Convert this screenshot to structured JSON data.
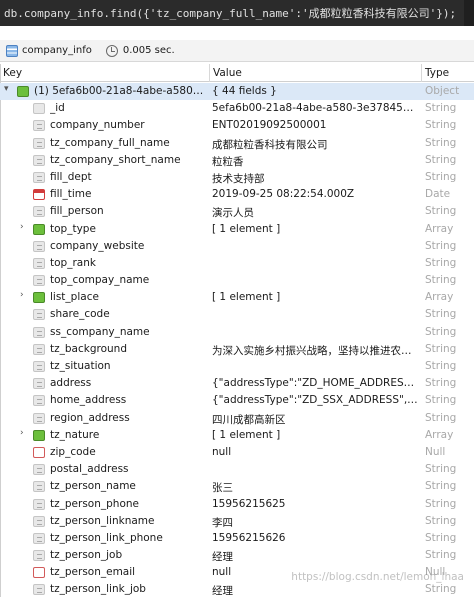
{
  "query": "db.company_info.find({'tz_company_full_name':'成都粒粒香科技有限公司'});",
  "status": {
    "collection": "company_info",
    "elapsed": "0.005 sec."
  },
  "columns": {
    "key": "Key",
    "value": "Value",
    "type": "Type"
  },
  "rows": [
    {
      "key": "(1) 5efa6b00-21a8-4abe-a580-3e3...",
      "value": "{ 44 fields }",
      "type": "Object",
      "icon": "obj",
      "expander": "▾"
    },
    {
      "key": "_id",
      "value": "5efa6b00-21a8-4abe-a580-3e378458f9c3",
      "type": "String",
      "icon": "id"
    },
    {
      "key": "company_number",
      "value": "ENT02019092500001",
      "type": "String",
      "icon": "str"
    },
    {
      "key": "tz_company_full_name",
      "value": "成都粒粒香科技有限公司",
      "type": "String",
      "icon": "str"
    },
    {
      "key": "tz_company_short_name",
      "value": "粒粒香",
      "type": "String",
      "icon": "str"
    },
    {
      "key": "fill_dept",
      "value": "技术支持部",
      "type": "String",
      "icon": "str"
    },
    {
      "key": "fill_time",
      "value": "2019-09-25 08:22:54.000Z",
      "type": "Date",
      "icon": "date"
    },
    {
      "key": "fill_person",
      "value": "演示人员",
      "type": "String",
      "icon": "str"
    },
    {
      "key": "top_type",
      "value": "[ 1 element ]",
      "type": "Array",
      "icon": "arr",
      "expander": "›"
    },
    {
      "key": "company_website",
      "value": "",
      "type": "String",
      "icon": "str"
    },
    {
      "key": "top_rank",
      "value": "",
      "type": "String",
      "icon": "str"
    },
    {
      "key": "top_compay_name",
      "value": "",
      "type": "String",
      "icon": "str"
    },
    {
      "key": "list_place",
      "value": "[ 1 element ]",
      "type": "Array",
      "icon": "arr",
      "expander": "›"
    },
    {
      "key": "share_code",
      "value": "",
      "type": "String",
      "icon": "str"
    },
    {
      "key": "ss_company_name",
      "value": "",
      "type": "String",
      "icon": "str"
    },
    {
      "key": "tz_background",
      "value": "为深入实施乡村振兴战略，坚持以推进农业供...",
      "type": "String",
      "icon": "str"
    },
    {
      "key": "tz_situation",
      "value": "",
      "type": "String",
      "icon": "str"
    },
    {
      "key": "address",
      "value": "{\"addressType\":\"ZD_HOME_ADDRESS\",\"pr...",
      "type": "String",
      "icon": "str"
    },
    {
      "key": "home_address",
      "value": "{\"addressType\":\"ZD_SSX_ADDRESS\",\"prov...",
      "type": "String",
      "icon": "str"
    },
    {
      "key": "region_address",
      "value": "四川成都高新区",
      "type": "String",
      "icon": "str"
    },
    {
      "key": "tz_nature",
      "value": "[ 1 element ]",
      "type": "Array",
      "icon": "arr",
      "expander": "›"
    },
    {
      "key": "zip_code",
      "value": "null",
      "type": "Null",
      "icon": "nul"
    },
    {
      "key": "postal_address",
      "value": "",
      "type": "String",
      "icon": "str"
    },
    {
      "key": "tz_person_name",
      "value": "张三",
      "type": "String",
      "icon": "str"
    },
    {
      "key": "tz_person_phone",
      "value": "15956215625",
      "type": "String",
      "icon": "str"
    },
    {
      "key": "tz_person_linkname",
      "value": "李四",
      "type": "String",
      "icon": "str"
    },
    {
      "key": "tz_person_link_phone",
      "value": "15956215626",
      "type": "String",
      "icon": "str"
    },
    {
      "key": "tz_person_job",
      "value": "经理",
      "type": "String",
      "icon": "str"
    },
    {
      "key": "tz_person_email",
      "value": "null",
      "type": "Null",
      "icon": "nul"
    },
    {
      "key": "tz_person_link_job",
      "value": "经理",
      "type": "String",
      "icon": "str"
    }
  ],
  "watermark": "https://blog.csdn.net/lemon_lhaa"
}
